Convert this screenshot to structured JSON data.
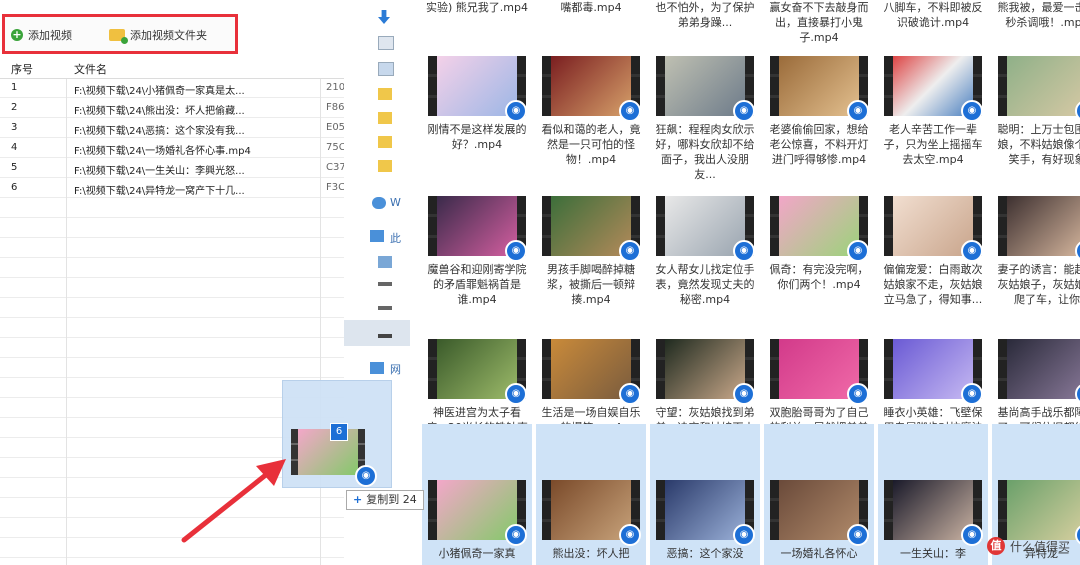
{
  "toolbar": {
    "add_video_label": "添加视频",
    "add_folder_label": "添加视频文件夹"
  },
  "grid": {
    "headers": {
      "no": "序号",
      "name": "文件名"
    },
    "rows": [
      {
        "no": "1",
        "path": "F:\\视频下载\\24\\小猪佩奇一家真是太...",
        "size": "210"
      },
      {
        "no": "2",
        "path": "F:\\视频下载\\24\\熊出没：坏人把偷藏...",
        "size": "F86"
      },
      {
        "no": "3",
        "path": "F:\\视频下载\\24\\恶搞：这个家没有我...",
        "size": "E05"
      },
      {
        "no": "4",
        "path": "F:\\视频下载\\24\\一场婚礼各怀心事.mp4",
        "size": "75C"
      },
      {
        "no": "5",
        "path": "F:\\视频下载\\24\\一生关山：李興光怒...",
        "size": "C37"
      },
      {
        "no": "6",
        "path": "F:\\视频下载\\24\\异特龙一窝产下十几...",
        "size": "F3C"
      }
    ]
  },
  "explorer": {
    "nav": [
      {
        "label": "W"
      },
      {
        "label": "此"
      },
      {
        "label": "网"
      }
    ],
    "top_captions": [
      "实验)  熊兄我了.mp4",
      "嘴都毒.mp4",
      "也不怕外，为了保护弟弟身躁...",
      "赢女奋不下去敲身而出，直接暴打小鬼子.mp4",
      "八脚车，不料即被反识破诡计.mp4",
      "熊我被，最爱一击，秒杀调哦！.mp4"
    ],
    "tiles": [
      "刚情不是这样发展的好？.mp4",
      "看似和蔼的老人，竟然是一只可怕的怪物！.mp4",
      "狂飙：程程肉女欣示好，哪料女欣却不给面子，我出人没朋友...",
      "老婆偷偷回家，想给老公惊喜，不料开灯进门呼得够惨.mp4",
      "老人辛苦工作一辈子，只为坐上摇摇车去太空.mp4",
      "聪明：上万士包围姑娘，不料姑娘像个傻笑手，有好现象",
      "魔兽谷和迎刚寄学院的矛盾罪魁祸首是谁.mp4",
      "男孩手脚喝醉掉糖浆，被撕后一顿辩揍.mp4",
      "女人帮女儿找定位手表，竟然发现丈夫的秘密.mp4",
      "佩奇：有完没完啊，你们两个！.mp4",
      "偏偏宠爱：白雨敢次姑娘家不走，灰姑娘立马急了，得知事...",
      "妻子的诱言：能赶紧灰姑娘子，灰姑娘直爬了车，让你",
      "神医进宫为太子看病，20米长的铁针直接抽出穴道，吓傻众人...",
      "生活是一场自娱自乐的爆笑.mp4",
      "守望：灰姑娘找到弟弟，决定和姑娘下山住酒店，也原谅了...",
      "双胞胎哥哥为了自己的利益，居然把弟弟给给.mp4",
      "睡衣小英雄：飞壁保用专属脚步对抗魔法弟子，效果太棒啦.mp4",
      "基尚高手战乐都障得了，可们依旧都终身到.mp4",
      "小猪佩奇一家真",
      "熊出没：坏人把",
      "恶搞：这个家没",
      "一场婚礼各怀心",
      "一生关山：李",
      "异特龙一"
    ],
    "selected_count": "6"
  },
  "drag": {
    "count": "6",
    "tooltip": "复制到 24"
  },
  "watermark": {
    "text": "什么值得买",
    "icon_text": "值"
  }
}
